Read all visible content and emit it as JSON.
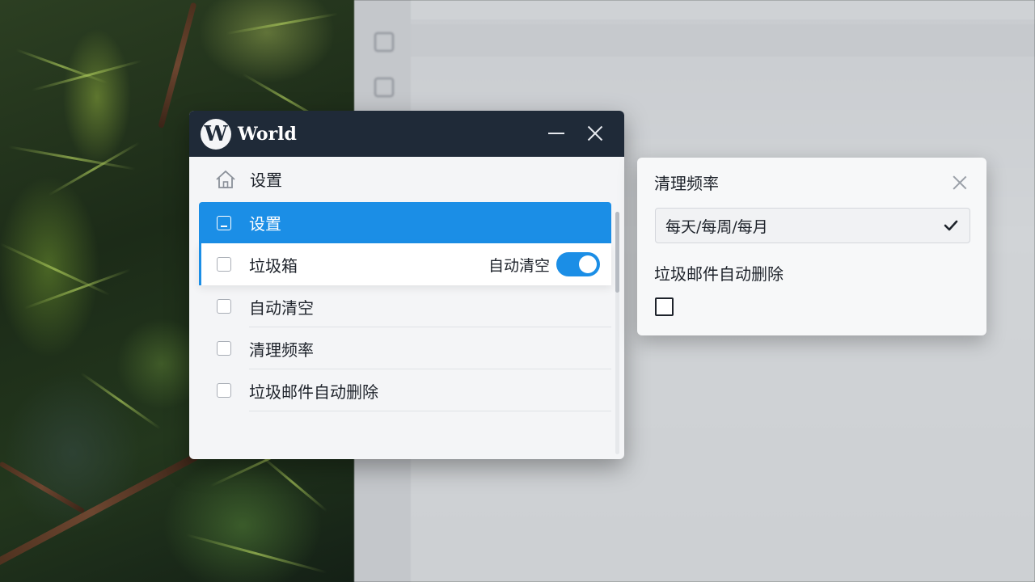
{
  "window": {
    "logo_letter": "W",
    "title": "World"
  },
  "header": {
    "label": "设置"
  },
  "list": {
    "items": [
      {
        "label": "设置"
      },
      {
        "label": "垃圾箱",
        "toggle_label": "自动清空"
      },
      {
        "label": "自动清空"
      },
      {
        "label": "清理频率"
      },
      {
        "label": "垃圾邮件自动删除"
      }
    ]
  },
  "popover": {
    "title": "清理频率",
    "select_value": "每天/每周/每月",
    "checkbox_label": "垃圾邮件自动删除"
  },
  "colors": {
    "accent": "#1b8ee6",
    "titlebar": "#1f2a38"
  }
}
